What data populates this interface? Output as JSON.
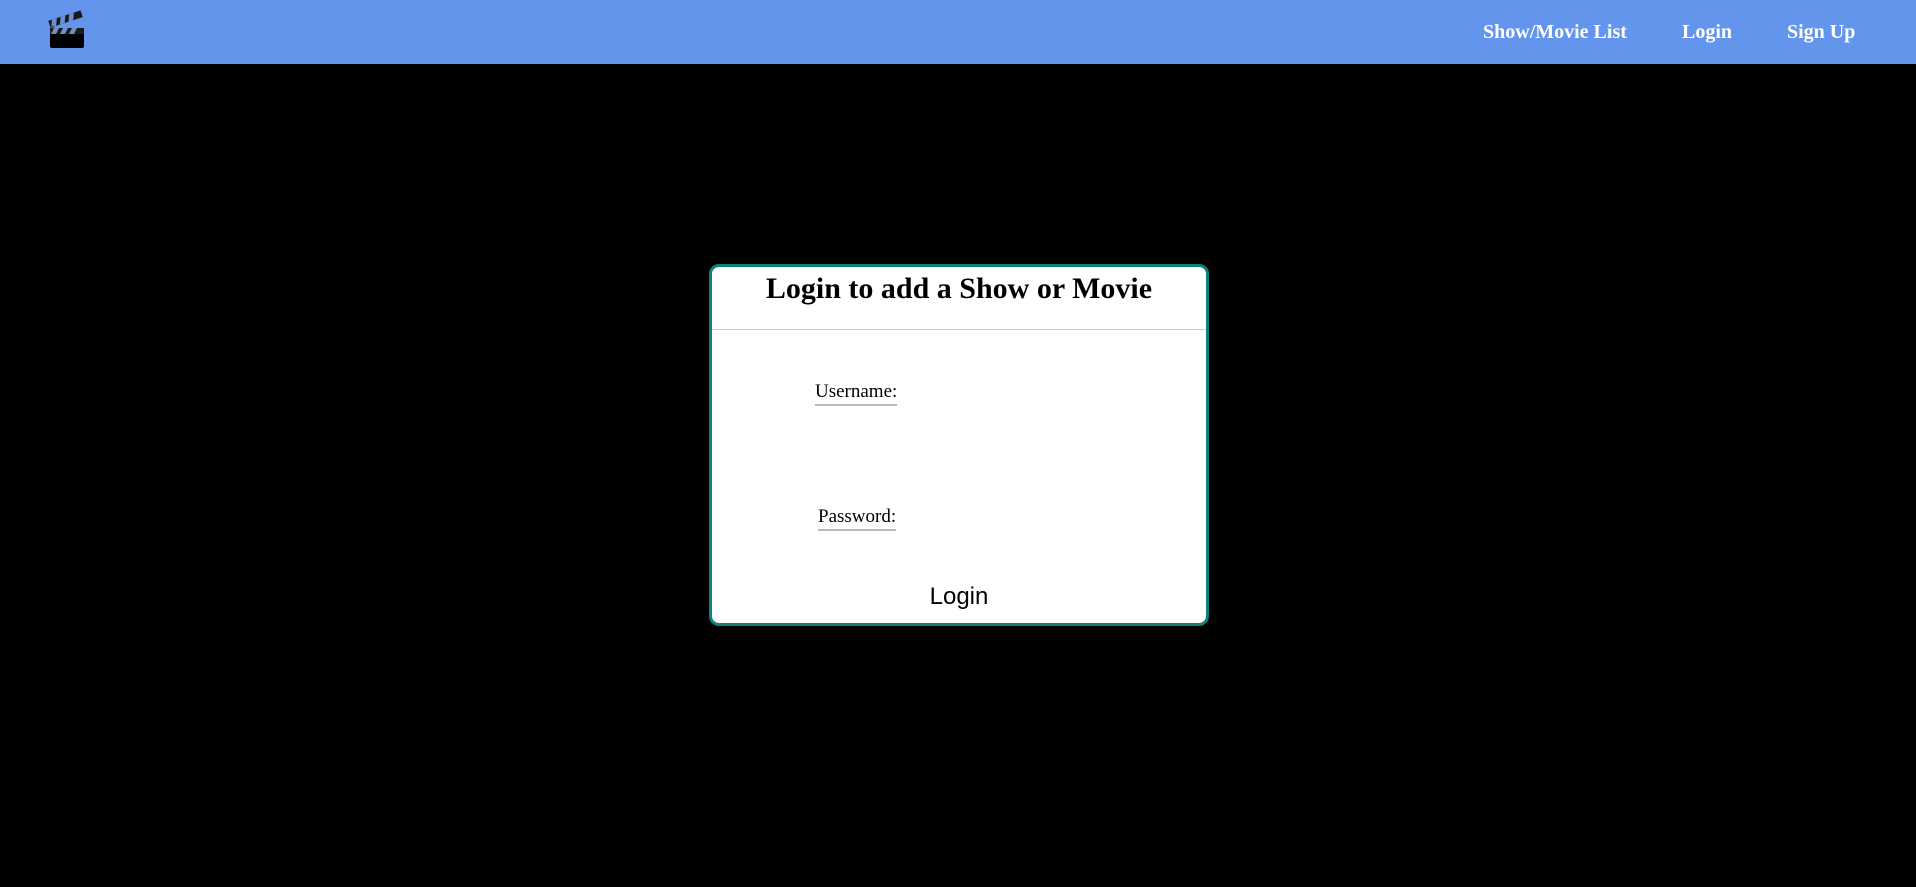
{
  "navbar": {
    "logo_icon": "clapperboard-icon",
    "background_color": "#6495ed",
    "links": [
      "Show/Movie List",
      "Login",
      "Sign Up"
    ]
  },
  "login_card": {
    "title": "Login to add a Show or Movie",
    "border_color": "#0f8080",
    "username_label": "Username:",
    "username_value": "",
    "password_label": "Password:",
    "password_value": "",
    "submit_label": "Login"
  }
}
